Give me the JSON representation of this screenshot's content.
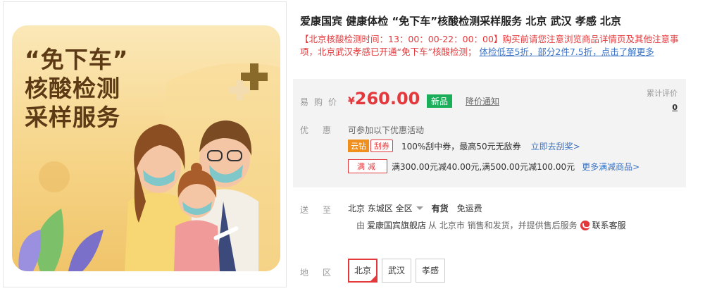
{
  "poster": {
    "line1": "“免下车”",
    "line2": "核酸检测",
    "line3": "采样服务"
  },
  "product": {
    "title": "爱康国宾 健康体检 “免下车”核酸检测采样服务 北京 武汉 孝感 北京",
    "notice_text": "【北京核酸检测时间：13：00：00-22：00：00】购买前请您注意浏览商品详情页及其他注意事项，北京武汉孝感已开通“免下车”核酸检测；",
    "notice_link": "体检低至5折，部分2件7.5折，点击了解更多"
  },
  "price": {
    "label": "易购价",
    "currency": "¥",
    "value": "260.00",
    "tag": "新品",
    "notify": "降价通知",
    "eval_label": "累计评价",
    "eval_count": "0"
  },
  "promo": {
    "label": "优惠",
    "title": "可参加以下优惠活动",
    "badge1": "云钻",
    "badge2": "刮券",
    "row1_text": "100%刮中券，最高50元无敌券",
    "row1_link": "立即去刮奖>",
    "badge3": "满减",
    "row2_text": "满300.00元减40.00元,满500.00元减100.00元",
    "row2_link": "更多满减商品>"
  },
  "shipping": {
    "label": "送至",
    "location": "北京 东城区 全区",
    "stock": "有货",
    "fee": "免运费",
    "seller_prefix": "由",
    "store": "爱康国宾旗舰店",
    "seller_suffix": "从 北京市 销售和发货，并提供售后服务",
    "cs": "联系客服"
  },
  "area": {
    "label": "地区",
    "options": [
      "北京",
      "武汉",
      "孝感"
    ]
  },
  "colors": {
    "accent_red": "#e4393c",
    "link_blue": "#3b73c4",
    "tag_green": "#1aae5a",
    "yundiamond_orange": "#ef8f1e"
  }
}
